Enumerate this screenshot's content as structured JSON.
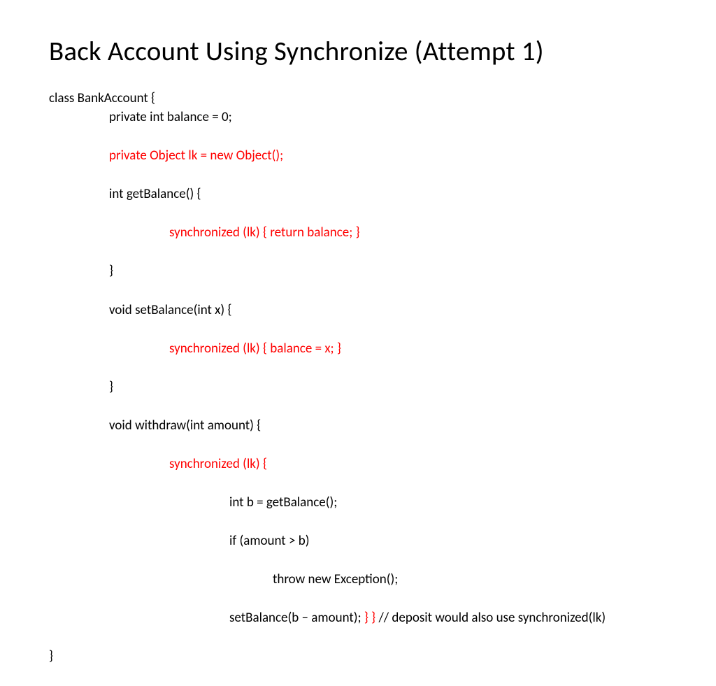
{
  "title": "Back Account Using Synchronize (Attempt 1)",
  "code": {
    "l1": "class BankAccount {",
    "l2": "private int balance = 0;",
    "l3": "private Object lk = new Object();",
    "l4": "int getBalance() {",
    "l5": "synchronized (lk) { return balance; }",
    "l6": "}",
    "l7": "void setBalance(int x) {",
    "l8": "synchronized (lk) { balance = x; }",
    "l9": "}",
    "l10": "void withdraw(int amount) {",
    "l11": "synchronized (lk) {",
    "l12": "int b = getBalance();",
    "l13": "if (amount > b)",
    "l14": "throw new Exception();",
    "l15a": "setBalance(b – amount); ",
    "l15b": "} } ",
    "l15c": "// deposit would also use synchronized(lk)",
    "l16": "}"
  }
}
